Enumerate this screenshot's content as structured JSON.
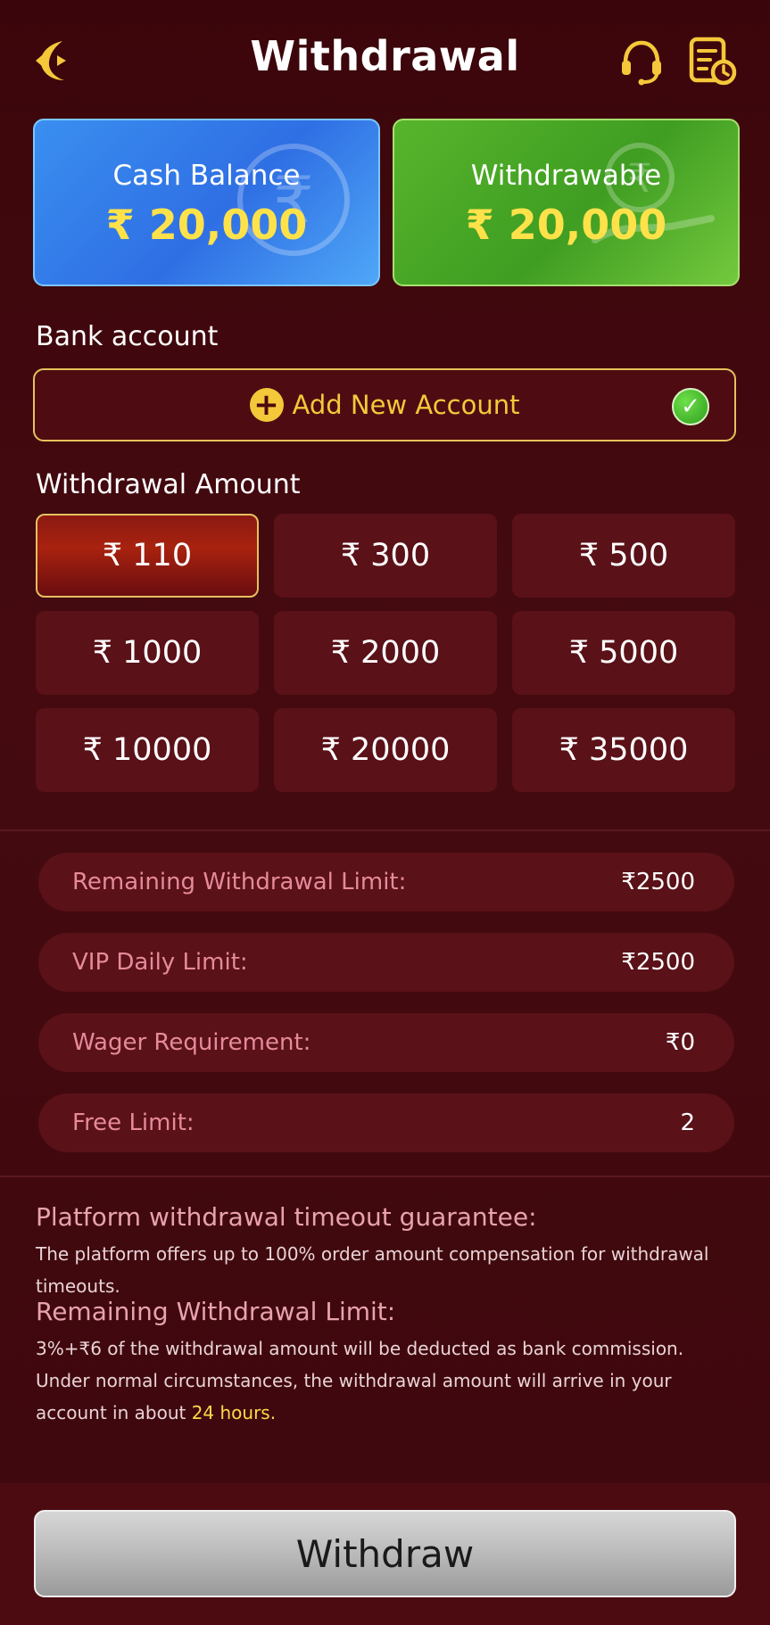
{
  "header": {
    "title": "Withdrawal",
    "back_icon": "crescent-back-icon",
    "support_icon": "headset-icon",
    "records_icon": "records-clock-icon",
    "accent_color": "#f5c83a"
  },
  "balances": {
    "cash": {
      "label": "Cash Balance",
      "value": "₹ 20,000"
    },
    "withdrawable": {
      "label": "Withdrawable",
      "value": "₹ 20,000"
    }
  },
  "bank": {
    "label": "Bank account",
    "add_label": "Add New Account",
    "add_icon": "plus-circle-icon",
    "status_icon": "check-circle-icon"
  },
  "amount": {
    "label": "Withdrawal Amount",
    "options": [
      "₹ 110",
      "₹ 300",
      "₹ 500",
      "₹ 1000",
      "₹ 2000",
      "₹ 5000",
      "₹ 10000",
      "₹ 20000",
      "₹ 35000"
    ],
    "selected": "₹ 110"
  },
  "limits": [
    {
      "label": "Remaining Withdrawal Limit:",
      "value": "₹2500"
    },
    {
      "label": "VIP Daily Limit:",
      "value": "₹2500"
    },
    {
      "label": "Wager Requirement:",
      "value": "₹0"
    },
    {
      "label": "Free Limit:",
      "value": "2"
    }
  ],
  "info": {
    "guarantee_title": "Platform withdrawal timeout guarantee:",
    "guarantee_text": "The platform offers up to 100% order amount compensation for withdrawal timeouts.",
    "limit_title": "Remaining Withdrawal Limit:",
    "limit_line1": "3%+₹6 of the withdrawal amount will be deducted as bank commission.",
    "limit_line2": "Under normal circumstances, the withdrawal amount will arrive in your",
    "limit_line3_prefix": "account in about ",
    "limit_line3_highlight": "24 hours."
  },
  "footer": {
    "withdraw_label": "Withdraw"
  }
}
